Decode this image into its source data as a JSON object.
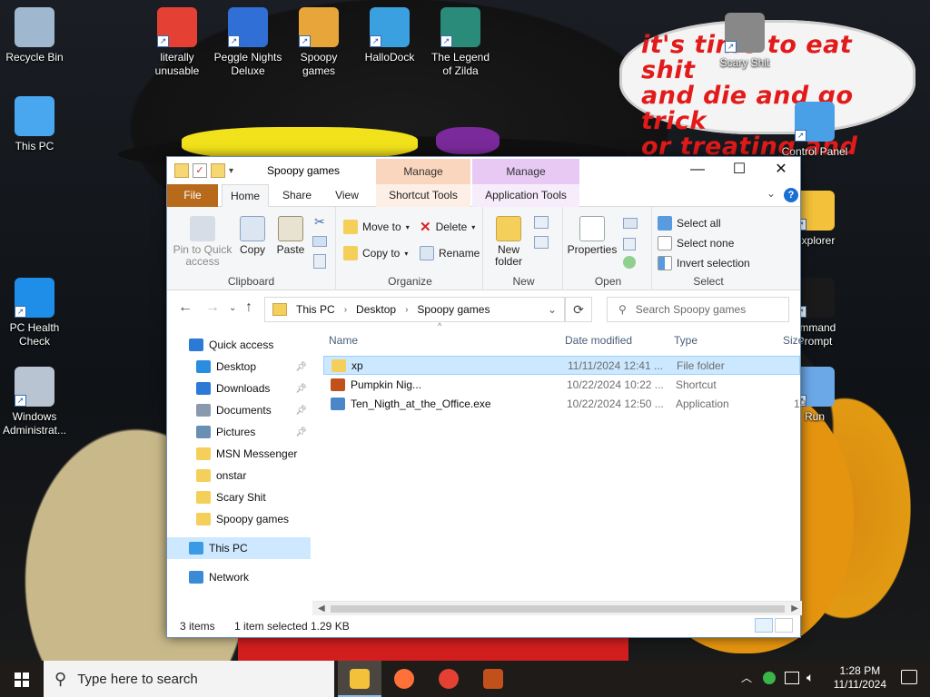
{
  "desktop": {
    "speech_bubble": [
      "it's time to eat shit",
      "and die and go trick",
      "or treating and die!"
    ],
    "icons": [
      {
        "label": "Recycle Bin",
        "icon": "recycle-bin-icon",
        "color": "#9fb7cf"
      },
      {
        "label": "This PC",
        "icon": "computer-icon",
        "color": "#49a7f0"
      },
      {
        "label": "PC Health Check",
        "icon": "health-heart-icon",
        "color": "#1f8ee8"
      },
      {
        "label": "Windows Administrat...",
        "icon": "admin-tools-icon",
        "color": "#b8c4d2"
      },
      {
        "label": "literally unusable",
        "icon": "chrome-icon",
        "color": "#e44134"
      },
      {
        "label": "Peggle Nights Deluxe",
        "icon": "peggle-icon",
        "color": "#2f6fd6"
      },
      {
        "label": "Spoopy games",
        "icon": "folder-icon",
        "color": "#e8a53a"
      },
      {
        "label": "HalloDock",
        "icon": "windows-logo-icon",
        "color": "#3aa0e0"
      },
      {
        "label": "The Legend of Zilda",
        "icon": "zilda-character-icon",
        "color": "#2a8b7a"
      },
      {
        "label": "Scary Shit",
        "icon": "scary-folder-icon",
        "color": "#888888"
      },
      {
        "label": "Control Panel",
        "icon": "control-panel-icon",
        "color": "#4aa0e6"
      },
      {
        "label": "Explorer",
        "icon": "file-explorer-icon",
        "color": "#f3c13a"
      },
      {
        "label": "ommand\nPrompt",
        "icon": "command-prompt-icon",
        "color": "#1a1a1a"
      },
      {
        "label": "Run",
        "icon": "run-icon",
        "color": "#6aa8e8"
      }
    ]
  },
  "window": {
    "title": "Spoopy games",
    "context_tab_headers": [
      "Manage",
      "Manage"
    ],
    "tabs": [
      "File",
      "Home",
      "Share",
      "View",
      "Shortcut Tools",
      "Application Tools"
    ],
    "ribbon": {
      "clipboard": {
        "label": "Clipboard",
        "pin": "Pin to Quick access",
        "copy": "Copy",
        "paste": "Paste"
      },
      "organize": {
        "label": "Organize",
        "move_to": "Move to",
        "copy_to": "Copy to",
        "delete": "Delete",
        "rename": "Rename"
      },
      "new": {
        "label": "New",
        "new_folder": "New folder"
      },
      "open": {
        "label": "Open",
        "properties": "Properties"
      },
      "select": {
        "label": "Select",
        "select_all": "Select all",
        "select_none": "Select none",
        "invert": "Invert selection"
      }
    },
    "address": {
      "crumbs": [
        "This PC",
        "Desktop",
        "Spoopy games"
      ],
      "search_placeholder": "Search Spoopy games"
    },
    "nav": [
      {
        "label": "Quick access",
        "icon": "star-icon",
        "color": "#2a7ad6",
        "level": 0,
        "pinned": false
      },
      {
        "label": "Desktop",
        "icon": "desktop-icon",
        "color": "#2a8ee0",
        "level": 1,
        "pinned": true
      },
      {
        "label": "Downloads",
        "icon": "download-icon",
        "color": "#2a7ad6",
        "level": 1,
        "pinned": true
      },
      {
        "label": "Documents",
        "icon": "document-icon",
        "color": "#8a9aae",
        "level": 1,
        "pinned": true
      },
      {
        "label": "Pictures",
        "icon": "pictures-icon",
        "color": "#6a8fb4",
        "level": 1,
        "pinned": true
      },
      {
        "label": "MSN Messenger",
        "icon": "folder-icon",
        "color": "#f4cf5a",
        "level": 1,
        "pinned": false
      },
      {
        "label": "onstar",
        "icon": "folder-icon",
        "color": "#f4cf5a",
        "level": 1,
        "pinned": false
      },
      {
        "label": "Scary Shit",
        "icon": "folder-icon",
        "color": "#f4cf5a",
        "level": 1,
        "pinned": false
      },
      {
        "label": "Spoopy games",
        "icon": "folder-icon",
        "color": "#f4cf5a",
        "level": 1,
        "pinned": false
      },
      {
        "label": "This PC",
        "icon": "computer-icon",
        "color": "#3a9ae6",
        "level": 0,
        "pinned": false
      },
      {
        "label": "Network",
        "icon": "network-icon",
        "color": "#3a8ad6",
        "level": 0,
        "pinned": false
      }
    ],
    "columns": [
      "Name",
      "Date modified",
      "Type",
      "Size"
    ],
    "files": [
      {
        "name": "xp",
        "date": "11/11/2024 12:41 ...",
        "type": "File folder",
        "size": "",
        "icon": "folder-icon",
        "color": "#f4cf5a",
        "selected": true
      },
      {
        "name": "Pumpkin Nig...",
        "date": "10/22/2024 10:22 ...",
        "type": "Shortcut",
        "size": "",
        "icon": "pumpkin-shortcut-icon",
        "color": "#c2501a",
        "selected": false
      },
      {
        "name": "Ten_Nigth_at_the_Office.exe",
        "date": "10/22/2024 12:50 ...",
        "type": "Application",
        "size": "19",
        "icon": "application-icon",
        "color": "#4a86c8",
        "selected": false
      }
    ],
    "status": {
      "items": "3 items",
      "selected": "1 item selected",
      "size": "1.29 KB"
    }
  },
  "taskbar": {
    "search_placeholder": "Type here to search",
    "apps": [
      {
        "icon": "file-explorer-icon",
        "color": "#f3c13a",
        "active": true
      },
      {
        "icon": "firefox-icon",
        "color": "#ff7139",
        "active": false
      },
      {
        "icon": "chrome-icon",
        "color": "#e44134",
        "active": false
      },
      {
        "icon": "game-app-icon",
        "color": "#c2501a",
        "active": false
      }
    ],
    "time": "1:28 PM",
    "date": "11/11/2024"
  }
}
